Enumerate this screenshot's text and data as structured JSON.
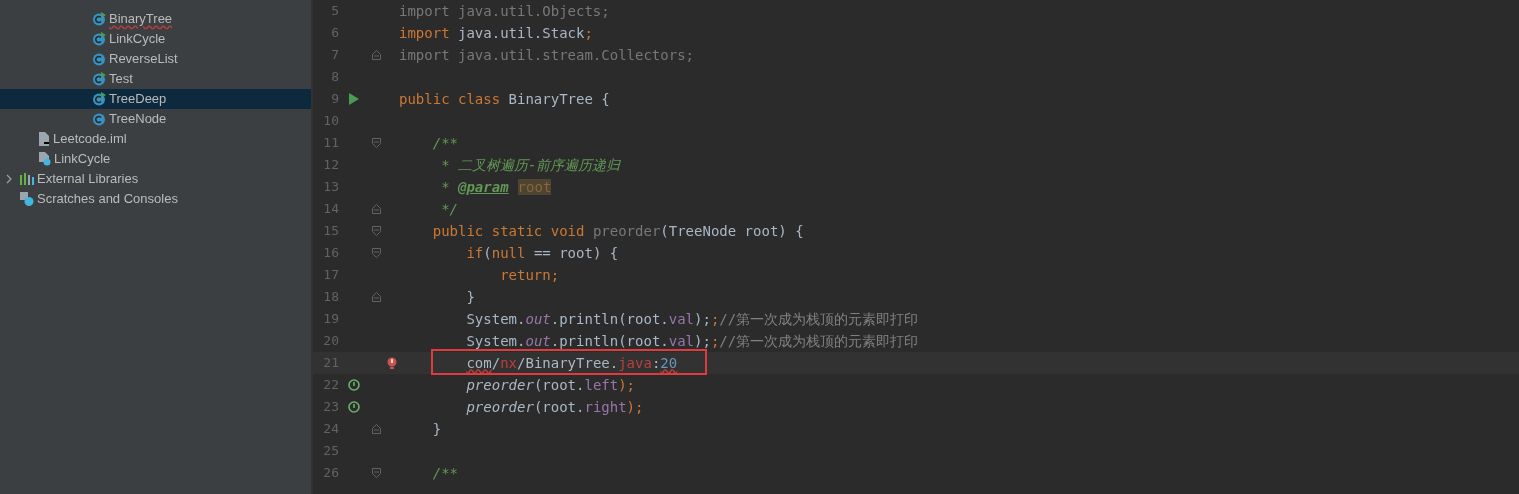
{
  "project_tree": [
    {
      "children": [
        {
          "children": [
            {
              "children": [
                {
                  "children": [
                    {
                      "label": "BinaryTree",
                      "kind": "class-runnable",
                      "selected": false,
                      "error": true
                    },
                    {
                      "label": "LinkCycle",
                      "kind": "class-runnable",
                      "selected": false,
                      "error": false
                    },
                    {
                      "label": "ReverseList",
                      "kind": "class",
                      "selected": false,
                      "error": false
                    },
                    {
                      "label": "Test",
                      "kind": "class-runnable",
                      "selected": false,
                      "error": false
                    },
                    {
                      "label": "TreeDeep",
                      "kind": "class-runnable",
                      "selected": true,
                      "error": false
                    },
                    {
                      "label": "TreeNode",
                      "kind": "class",
                      "selected": false,
                      "error": false
                    }
                  ]
                }
              ]
            }
          ]
        },
        {
          "label": "Leetcode.iml",
          "kind": "iml-file",
          "selected": false,
          "error": false
        },
        {
          "label": "LinkCycle",
          "kind": "unknown-file",
          "selected": false,
          "error": false
        }
      ]
    },
    {
      "label": "External Libraries",
      "kind": "library",
      "expanded": false,
      "selected": false,
      "error": false
    },
    {
      "label": "Scratches and Consoles",
      "kind": "scratches",
      "selected": false,
      "error": false
    }
  ],
  "editor": {
    "lines": [
      {
        "number": "5",
        "tokens": [
          {
            "text": "import java.util.Objects;",
            "kind": "unused"
          }
        ]
      },
      {
        "number": "6",
        "tokens": [
          {
            "text": "import ",
            "kind": "keyword"
          },
          {
            "text": "java.util.Stack",
            "kind": "plain"
          },
          {
            "text": ";",
            "kind": "keyword"
          }
        ]
      },
      {
        "number": "7",
        "fold_marker": {
          "kind": "close"
        },
        "tokens": [
          {
            "text": "import java.util.stream.Collectors;",
            "kind": "unused"
          }
        ]
      },
      {
        "number": "8"
      },
      {
        "number": "9",
        "gutter_icon": {
          "kind": "run"
        },
        "tokens": [
          {
            "text": "public class ",
            "kind": "keyword"
          },
          {
            "text": "BinaryTree {",
            "kind": "plain"
          }
        ]
      },
      {
        "number": "10"
      },
      {
        "number": "11",
        "fold_marker": {
          "kind": "open"
        },
        "tokens": [
          {
            "text": "    /**",
            "kind": "doc"
          }
        ]
      },
      {
        "number": "12",
        "tokens": [
          {
            "text": "     * 二叉树遍历-前序遍历递归",
            "kind": "doc"
          }
        ]
      },
      {
        "number": "13",
        "tokens": [
          {
            "text": "     * ",
            "kind": "doc"
          },
          {
            "text": "@param",
            "kind": "doc-tag"
          },
          {
            "text": "root",
            "kind": "doc-param"
          }
        ]
      },
      {
        "number": "14",
        "fold_marker": {
          "kind": "close"
        },
        "tokens": [
          {
            "text": "     */",
            "kind": "doc"
          }
        ]
      },
      {
        "number": "15",
        "fold_marker": {
          "kind": "open"
        },
        "tokens": [
          {
            "text": "    public static void ",
            "kind": "keyword"
          },
          {
            "text": "preorder",
            "kind": "unused"
          },
          {
            "text": "(TreeNode root) {",
            "kind": "plain"
          }
        ]
      },
      {
        "number": "16",
        "fold_marker": {
          "kind": "open"
        },
        "tokens": [
          {
            "text": "        if",
            "kind": "keyword"
          },
          {
            "text": "(",
            "kind": "plain"
          },
          {
            "text": "null",
            "kind": "keyword"
          },
          {
            "text": " == root) {",
            "kind": "plain"
          }
        ]
      },
      {
        "number": "17",
        "tokens": [
          {
            "text": "            return;",
            "kind": "keyword"
          }
        ]
      },
      {
        "number": "18",
        "fold_marker": {
          "kind": "close"
        },
        "tokens": [
          {
            "text": "        }",
            "kind": "plain"
          }
        ]
      },
      {
        "number": "19",
        "tokens": [
          {
            "text": "        System.",
            "kind": "plain"
          },
          {
            "text": "out",
            "kind": "static-field"
          },
          {
            "text": ".println(root.",
            "kind": "plain"
          },
          {
            "text": "val",
            "kind": "field"
          },
          {
            "text": ");",
            "kind": "plain"
          },
          {
            "text": ";",
            "kind": "keyword"
          },
          {
            "text": "//第一次成为栈顶的元素即打印",
            "kind": "comment"
          }
        ]
      },
      {
        "number": "20",
        "tokens": [
          {
            "text": "        System.",
            "kind": "plain"
          },
          {
            "text": "out",
            "kind": "static-field"
          },
          {
            "text": ".println(root.",
            "kind": "plain"
          },
          {
            "text": "val",
            "kind": "field"
          },
          {
            "text": ");",
            "kind": "plain"
          },
          {
            "text": ";",
            "kind": "keyword"
          },
          {
            "text": "//第一次成为栈顶的元素即打印",
            "kind": "comment"
          }
        ]
      },
      {
        "number": "21",
        "gutter_icon": {
          "kind": "bulb"
        },
        "highlighted": true,
        "tokens": [
          {
            "text": "        com",
            "kind": "error"
          },
          {
            "text": "/",
            "kind": "plain"
          },
          {
            "text": "nx",
            "kind": "error-name"
          },
          {
            "text": "/BinaryTree.",
            "kind": "plain"
          },
          {
            "text": "java",
            "kind": "error-name"
          },
          {
            "text": ":",
            "kind": "plain"
          },
          {
            "text": "20",
            "kind": "error-number"
          }
        ]
      },
      {
        "number": "22",
        "gutter_icon": {
          "kind": "recursion"
        },
        "tokens": [
          {
            "text": "        preorder",
            "kind": "call"
          },
          {
            "text": "(root.",
            "kind": "plain"
          },
          {
            "text": "left",
            "kind": "field"
          },
          {
            "text": ");",
            "kind": "keyword"
          }
        ]
      },
      {
        "number": "23",
        "gutter_icon": {
          "kind": "recursion"
        },
        "tokens": [
          {
            "text": "        preorder",
            "kind": "call"
          },
          {
            "text": "(root.",
            "kind": "plain"
          },
          {
            "text": "right",
            "kind": "field"
          },
          {
            "text": ");",
            "kind": "keyword"
          }
        ]
      },
      {
        "number": "24",
        "fold_marker": {
          "kind": "close"
        },
        "tokens": [
          {
            "text": "    }",
            "kind": "plain"
          }
        ]
      },
      {
        "number": "25"
      },
      {
        "number": "26",
        "fold_marker": {
          "kind": "open"
        },
        "tokens": [
          {
            "text": "    /**",
            "kind": "doc"
          }
        ]
      }
    ]
  }
}
